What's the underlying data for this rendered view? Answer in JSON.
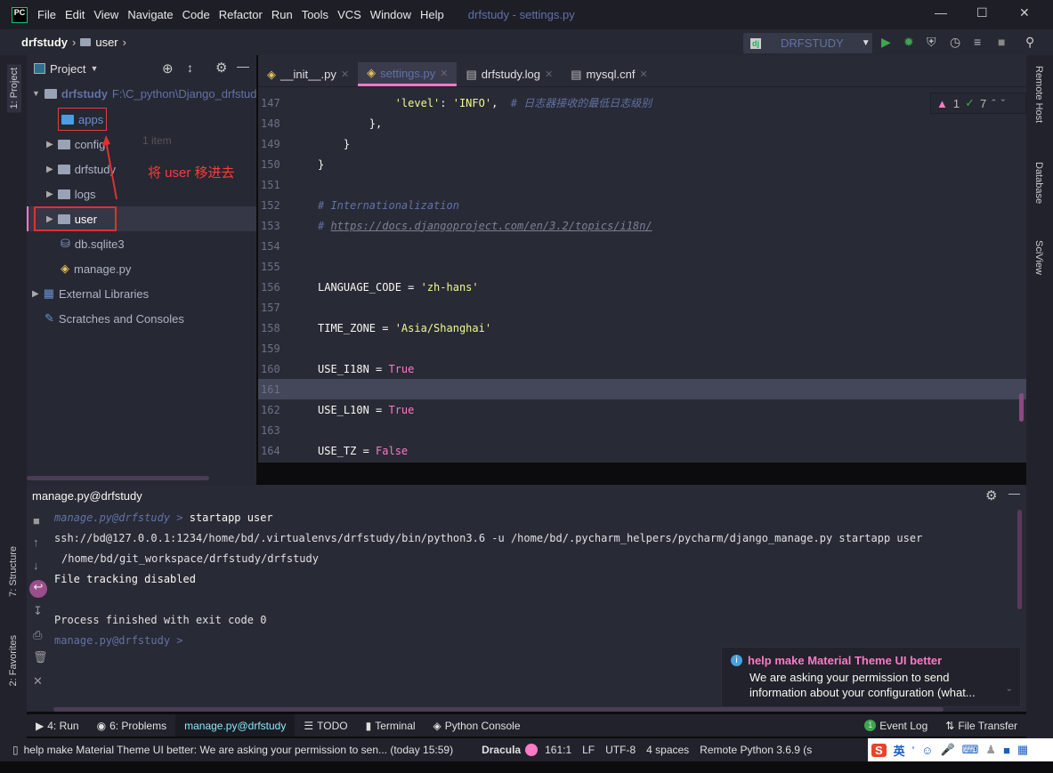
{
  "window": {
    "title": "drfstudy - settings.py",
    "logo": "PC",
    "menu": [
      "File",
      "Edit",
      "View",
      "Navigate",
      "Code",
      "Refactor",
      "Run",
      "Tools",
      "VCS",
      "Window",
      "Help"
    ]
  },
  "breadcrumb": [
    "drfstudy",
    "user"
  ],
  "run_config": {
    "label": "DRFSTUDY",
    "icon": "dj"
  },
  "left_strip": {
    "project": "1: Project",
    "structure": "7: Structure",
    "favorites": "2: Favorites"
  },
  "right_strip": [
    "Remote Host",
    "Database",
    "SciView"
  ],
  "project": {
    "header": "Project",
    "root": {
      "name": "drfstudy",
      "path": "F:\\C_python\\Django_drfstud"
    },
    "items": [
      "apps",
      "config",
      "drfstudy",
      "logs",
      "user",
      "db.sqlite3",
      "manage.py"
    ],
    "hint": "1 item",
    "external": "External Libraries",
    "scratches": "Scratches and Consoles",
    "annotation": "将 user 移进去"
  },
  "tabs": [
    {
      "label": "__init__.py"
    },
    {
      "label": "settings.py",
      "active": true
    },
    {
      "label": "drfstudy.log"
    },
    {
      "label": "mysql.cnf"
    }
  ],
  "inspections": {
    "warnings": "1",
    "ok": "7"
  },
  "code": [
    {
      "n": "147",
      "parts": [
        [
          "            ",
          ""
        ],
        [
          "'level'",
          "str"
        ],
        [
          ": ",
          ""
        ],
        [
          "'INFO'",
          "str"
        ],
        [
          ",  ",
          ""
        ],
        [
          "# 日志器接收的最低日志级别",
          "cm"
        ]
      ]
    },
    {
      "n": "148",
      "parts": [
        [
          "        },",
          ""
        ]
      ]
    },
    {
      "n": "149",
      "parts": [
        [
          "    }",
          ""
        ]
      ]
    },
    {
      "n": "150",
      "parts": [
        [
          "}",
          ""
        ]
      ]
    },
    {
      "n": "151",
      "parts": []
    },
    {
      "n": "152",
      "parts": [
        [
          "# Internationalization",
          "cm"
        ]
      ]
    },
    {
      "n": "153",
      "parts": [
        [
          "# ",
          "cm"
        ],
        [
          "https://docs.djangoproject.com/en/3.2/topics/i18n/",
          "url"
        ]
      ]
    },
    {
      "n": "154",
      "parts": []
    },
    {
      "n": "155",
      "parts": []
    },
    {
      "n": "156",
      "parts": [
        [
          "LANGUAGE_CODE = ",
          ""
        ],
        [
          "'zh-hans'",
          "str"
        ]
      ]
    },
    {
      "n": "157",
      "parts": []
    },
    {
      "n": "158",
      "parts": [
        [
          "TIME_ZONE = ",
          ""
        ],
        [
          "'Asia/Shanghai'",
          "str"
        ]
      ]
    },
    {
      "n": "159",
      "parts": []
    },
    {
      "n": "160",
      "parts": [
        [
          "USE_I18N = ",
          ""
        ],
        [
          "True",
          "kw"
        ]
      ]
    },
    {
      "n": "161",
      "parts": [],
      "current": true
    },
    {
      "n": "162",
      "parts": [
        [
          "USE_L10N = ",
          ""
        ],
        [
          "True",
          "kw"
        ]
      ]
    },
    {
      "n": "163",
      "parts": []
    },
    {
      "n": "164",
      "parts": [
        [
          "USE_TZ = ",
          ""
        ],
        [
          "False",
          "kw"
        ]
      ]
    }
  ],
  "console": {
    "title": "manage.py@drfstudy",
    "prompt": "manage.py@drfstudy >",
    "command": "startapp user",
    "line2": "ssh://bd@127.0.0.1:1234/home/bd/.virtualenvs/drfstudy/bin/python3.6 -u /home/bd/.pycharm_helpers/pycharm/django_manage.py startapp user",
    "line3": "/home/bd/git_workspace/drfstudy/drfstudy",
    "line4": "File tracking disabled",
    "line5": "Process finished with exit code 0",
    "prompt2": "manage.py@drfstudy >"
  },
  "notification": {
    "title": "help make Material Theme UI better",
    "body1": "We are asking your permission to send",
    "body2": "information about your configuration (what..."
  },
  "toolwindows": {
    "run": "4: Run",
    "problems": "6: Problems",
    "console": "manage.py@drfstudy",
    "todo": "TODO",
    "terminal": "Terminal",
    "python_console": "Python Console",
    "event_log": "Event Log",
    "event_count": "1",
    "file_transfer": "File Transfer"
  },
  "status": {
    "message": "help make Material Theme UI better: We are asking your permission to sen... (today 15:59)",
    "theme": "Dracula",
    "position": "161:1",
    "line_sep": "LF",
    "encoding": "UTF-8",
    "indent": "4 spaces",
    "interpreter": "Remote Python 3.6.9 (s"
  },
  "ime": {
    "lang": "英"
  },
  "colors": {
    "accent": "#ff79c6",
    "bg": "#282a36",
    "comment": "#6272a4",
    "string": "#f1fa8c"
  }
}
